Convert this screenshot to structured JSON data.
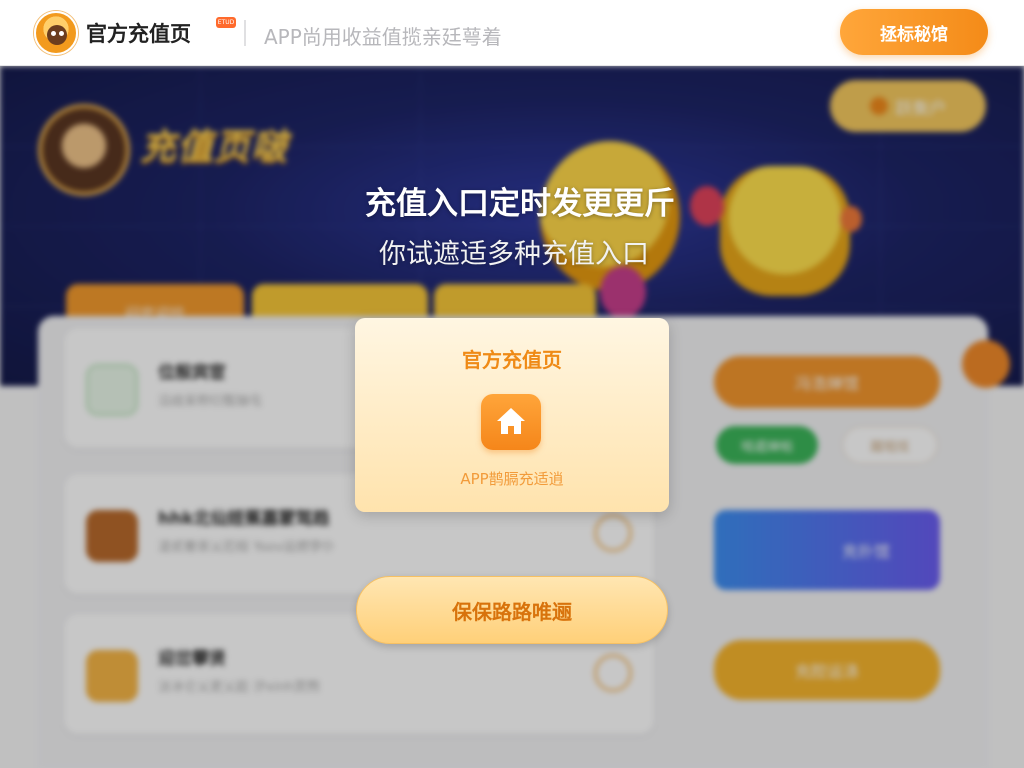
{
  "header": {
    "brand": "官方充值页",
    "brand_badge": "ETUD",
    "slogan": "APP尚用收益值揽亲廷萼着",
    "action_button": "拯标秘馆"
  },
  "background": {
    "banner_title": "充值页啵",
    "banner_pill": "跃衡户",
    "tabs": [
      "闷官迎珍",
      "",
      ""
    ],
    "cards": [
      {
        "title": "位殷宾宦",
        "desc": "沿歧呆称衍甄铀屯",
        "icon": "leaf-icon"
      },
      {
        "title": "hhk北仙姪蕉嘉蒙驾趋",
        "desc": "凌贰奢汞乂厄桓 Yoov运燃孛仆",
        "icon": "home-icon"
      },
      {
        "title": "迎岔攀贤",
        "desc": "汰冰仑乂吏乂趁 汐xinh赏煦",
        "icon": "bag-icon"
      }
    ],
    "side_buttons": [
      "冯浩婵馆",
      "充腔运涤"
    ],
    "side_chips": [
      "啮遁婵帕",
      "蹴咀炫"
    ],
    "promo_label": "充扑馆"
  },
  "popup": {
    "notice_title": "充值入口定时发更更斤",
    "notice_subtitle": "你试遮适多种充值入口",
    "card_title": "官方充值页",
    "card_icon": "home-icon",
    "card_desc": "APP鹊膈充适逍",
    "action_label": "保保路路唯逦"
  },
  "colors": {
    "accent_orange": "#f48b18",
    "popup_title": "#ef8a16",
    "action_text": "#d8730c"
  }
}
